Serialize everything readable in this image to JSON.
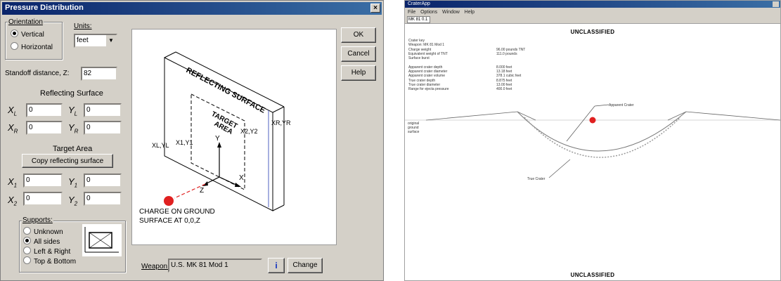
{
  "dialog": {
    "title": "Pressure Distribution",
    "orientation": {
      "label": "Orientation",
      "options": [
        "Vertical",
        "Horizontal"
      ],
      "selected": "Vertical"
    },
    "units": {
      "label": "Units:",
      "value": "feet"
    },
    "standoff": {
      "label": "Standoff distance, Z:",
      "value": "82"
    },
    "reflecting": {
      "title": "Reflecting Surface",
      "x1": "0",
      "y1": "0",
      "xr": "0",
      "yr": "0"
    },
    "target": {
      "title": "Target Area",
      "copy_button": "Copy reflecting surface",
      "x1": "0",
      "y1": "0",
      "x2": "0",
      "y2": "0"
    },
    "supports": {
      "label": "Supports:",
      "options": [
        "Unknown",
        "All sides",
        "Left & Right",
        "Top & Bottom"
      ],
      "selected": "All sides"
    },
    "buttons": {
      "ok": "OK",
      "cancel": "Cancel",
      "help": "Help",
      "change": "Change",
      "info": "i"
    },
    "weapon": {
      "label": "Weapon:",
      "value": "U.S. MK 81 Mod 1"
    },
    "diagram": {
      "reflecting_surface": "REFLECTING SURFACE",
      "target_area_1": "TARGET",
      "target_area_2": "AREA",
      "corner_br": "XR,YR",
      "corner_tl": "X1,Y1",
      "corner_mid": "X2,Y2",
      "corner_bl": "XL,YL",
      "axis_y": "Y",
      "axis_x": "X",
      "axis_z": "Z",
      "charge_1": "CHARGE ON GROUND",
      "charge_2": "SURFACE AT 0,0,Z"
    }
  },
  "window": {
    "title": "CraterApp",
    "menu": [
      "File",
      "Options",
      "Window",
      "Help"
    ],
    "toolbar_value": "MK 81 0.1",
    "classification_top": "UNCLASSIFIED",
    "classification_bottom": "UNCLASSIFIED",
    "info_lines": [
      [
        "Crater key",
        ""
      ],
      [
        "Weapon: MK 81 Mod 1",
        ""
      ],
      [
        "Charge weight",
        "96.00 pounds TNT"
      ],
      [
        "Equivalent weight of TNT",
        "111.0 pounds"
      ],
      [
        "Surface burst",
        ""
      ],
      [
        "",
        ""
      ],
      [
        "Apparent crater depth",
        "8.000 feet"
      ],
      [
        "Apparent crater diameter",
        "13.18 feet"
      ],
      [
        "Apparent crater volume",
        "378.1 cubic feet"
      ],
      [
        "True crater depth",
        "8.875 feet"
      ],
      [
        "True crater diameter",
        "13.00 feet"
      ],
      [
        "Range for ejecta pressure",
        "400.0 feet"
      ]
    ],
    "ground_label": [
      "original",
      "ground",
      "surface"
    ],
    "apparent_label": "Apparent Crater",
    "true_label": "True Crater",
    "charge_color": "#e02020"
  }
}
